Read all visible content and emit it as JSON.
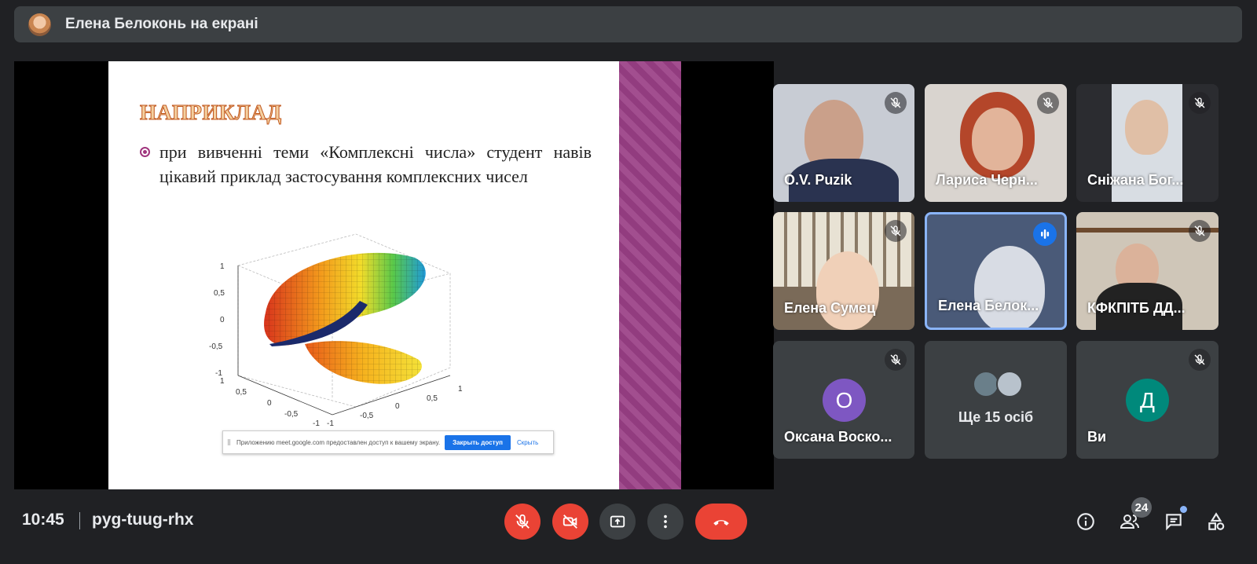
{
  "presenter_banner": {
    "title": "Елена Белоконь на екрані"
  },
  "slide": {
    "heading": "НАПРИКЛАД",
    "bullet_text": "при вивченні теми «Комплексні числа» студент навів цікавий приклад застосування комплексних чисел",
    "plot_ticks_z": [
      "1",
      "0,5",
      "0",
      "-0,5",
      "-1"
    ],
    "plot_ticks_x": [
      "1",
      "0,5",
      "0",
      "-0,5",
      "-1"
    ],
    "plot_ticks_y": [
      "-1",
      "-0,5",
      "0",
      "0,5",
      "1"
    ],
    "share_notice": {
      "message": "Приложению meet.google.com предоставлен доступ к вашему экрану.",
      "stop_label": "Закрыть доступ",
      "hide_label": "Скрыть"
    }
  },
  "participants": [
    {
      "name": "O.V. Puzik",
      "muted": true
    },
    {
      "name": "Лариса Черн...",
      "muted": true
    },
    {
      "name": "Сніжана Бог...",
      "muted": true
    },
    {
      "name": "Елена Сумец",
      "muted": true
    },
    {
      "name": "Елена Белок...",
      "speaking": true
    },
    {
      "name": "КФКПІТБ ДД...",
      "muted": true
    },
    {
      "name": "Оксана Воско...",
      "initial": "О",
      "color": "#7e57c2",
      "muted": true
    },
    {
      "name": "Ви",
      "initial": "Д",
      "color": "#00897b",
      "muted": true
    }
  ],
  "more_tile": {
    "label": "Ще 15 осіб"
  },
  "meeting": {
    "time": "10:45",
    "code": "pyg-tuug-rhx"
  },
  "controls": {
    "mic": "mic-off-icon",
    "camera": "camera-off-icon",
    "present": "present-icon",
    "more": "more-vert-icon",
    "leave": "call-end-icon"
  },
  "right_controls": {
    "participant_count": "24"
  },
  "colors": {
    "accent": "#8ab4f8",
    "danger": "#ea4335",
    "panel": "#3c4043",
    "bg": "#202124"
  }
}
